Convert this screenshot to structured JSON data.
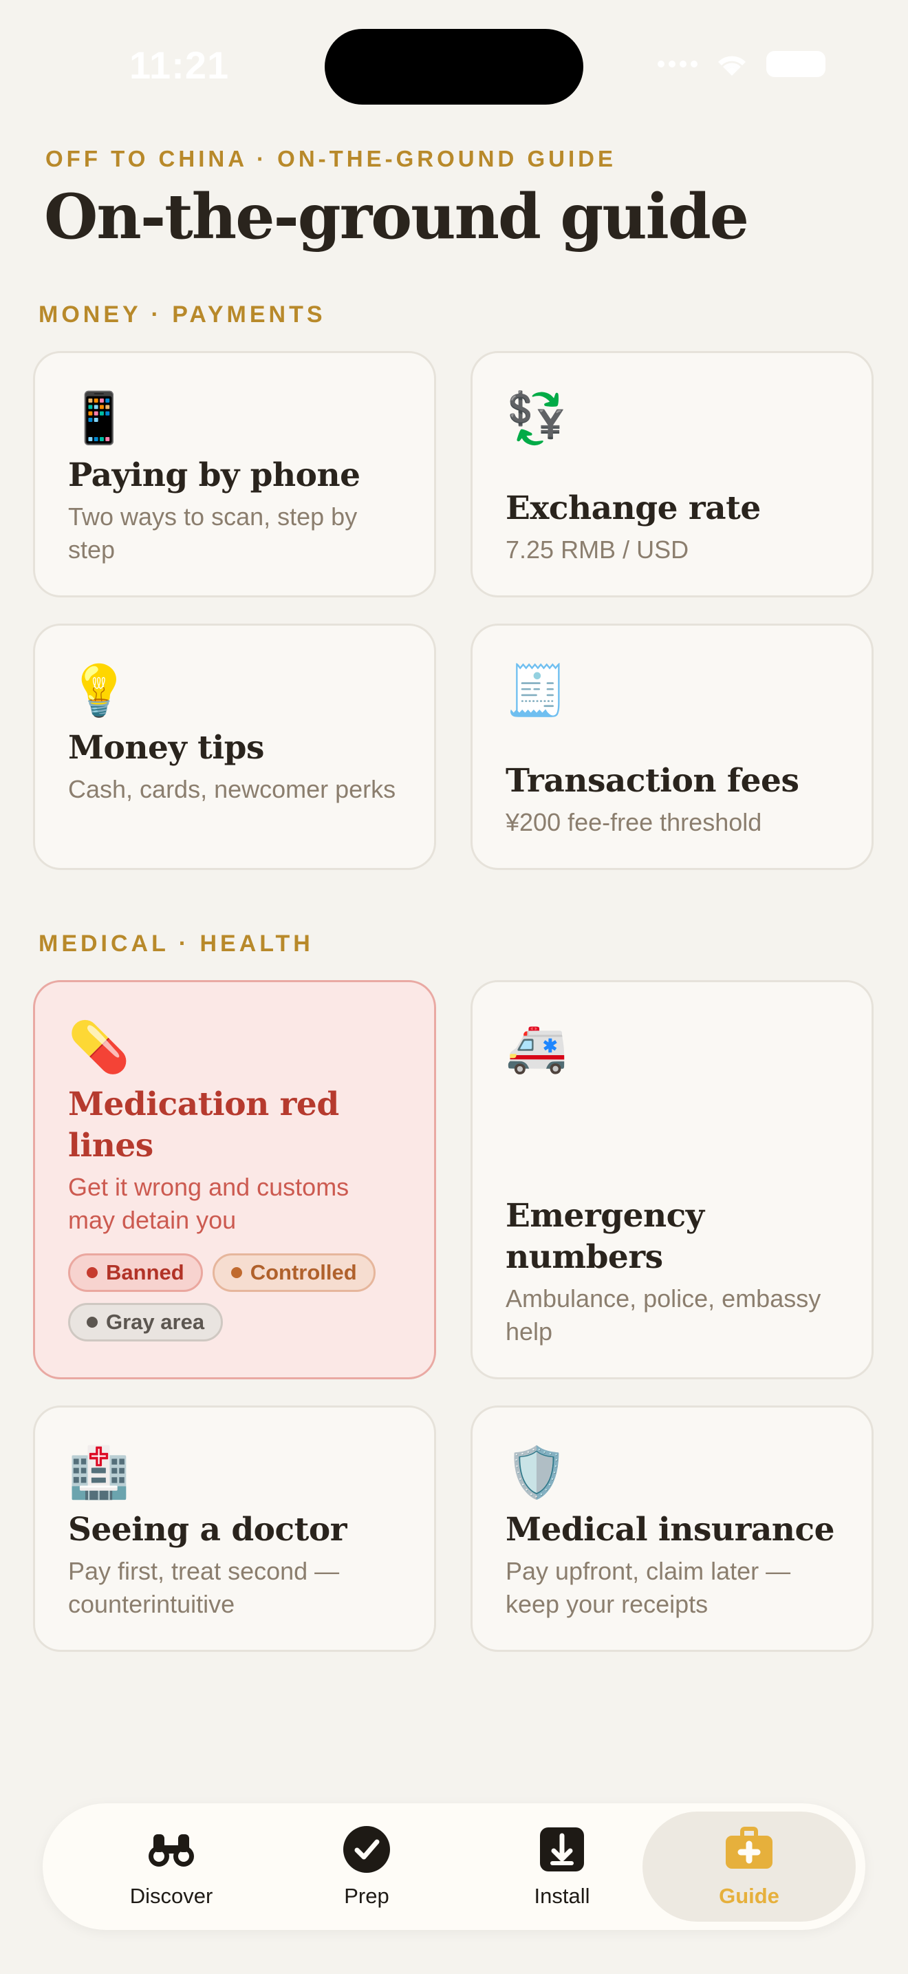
{
  "status": {
    "time": "11:21"
  },
  "header": {
    "eyebrow": "OFF TO CHINA · ON-THE-GROUND GUIDE",
    "title": "On-the-ground guide"
  },
  "sections": {
    "money": "MONEY · PAYMENTS",
    "medical": "MEDICAL · HEALTH"
  },
  "cards": {
    "paying": {
      "icon": "📱",
      "title": "Paying by phone",
      "subtitle": "Two ways to scan, step by step"
    },
    "exchange": {
      "icon": "💱",
      "title": "Exchange rate",
      "subtitle": "7.25 RMB / USD"
    },
    "tips": {
      "icon": "💡",
      "title": "Money tips",
      "subtitle": "Cash, cards, newcomer perks"
    },
    "fees": {
      "icon": "🧾",
      "title": "Transaction fees",
      "subtitle": "¥200 fee-free threshold"
    },
    "medication": {
      "icon": "💊",
      "title": "Medication red lines",
      "subtitle": "Get it wrong and customs may detain you",
      "tags": {
        "banned": "Banned",
        "controlled": "Controlled",
        "gray": "Gray area"
      }
    },
    "emergency": {
      "icon": "🚑",
      "title": "Emergency numbers",
      "subtitle": "Ambulance, police, embassy help"
    },
    "doctor": {
      "icon": "🏥",
      "title": "Seeing a doctor",
      "subtitle": "Pay first, treat second — counterintuitive"
    },
    "insurance": {
      "icon": "🛡️",
      "title": "Medical insurance",
      "subtitle": "Pay upfront, claim later — keep your receipts"
    }
  },
  "tabs": {
    "discover": "Discover",
    "prep": "Prep",
    "install": "Install",
    "guide": "Guide"
  },
  "colors": {
    "accent": "#b8892a",
    "active_tab": "#e6b03c",
    "alert": "#b63a2e",
    "background": "#f5f3ee"
  },
  "active_tab": "guide"
}
